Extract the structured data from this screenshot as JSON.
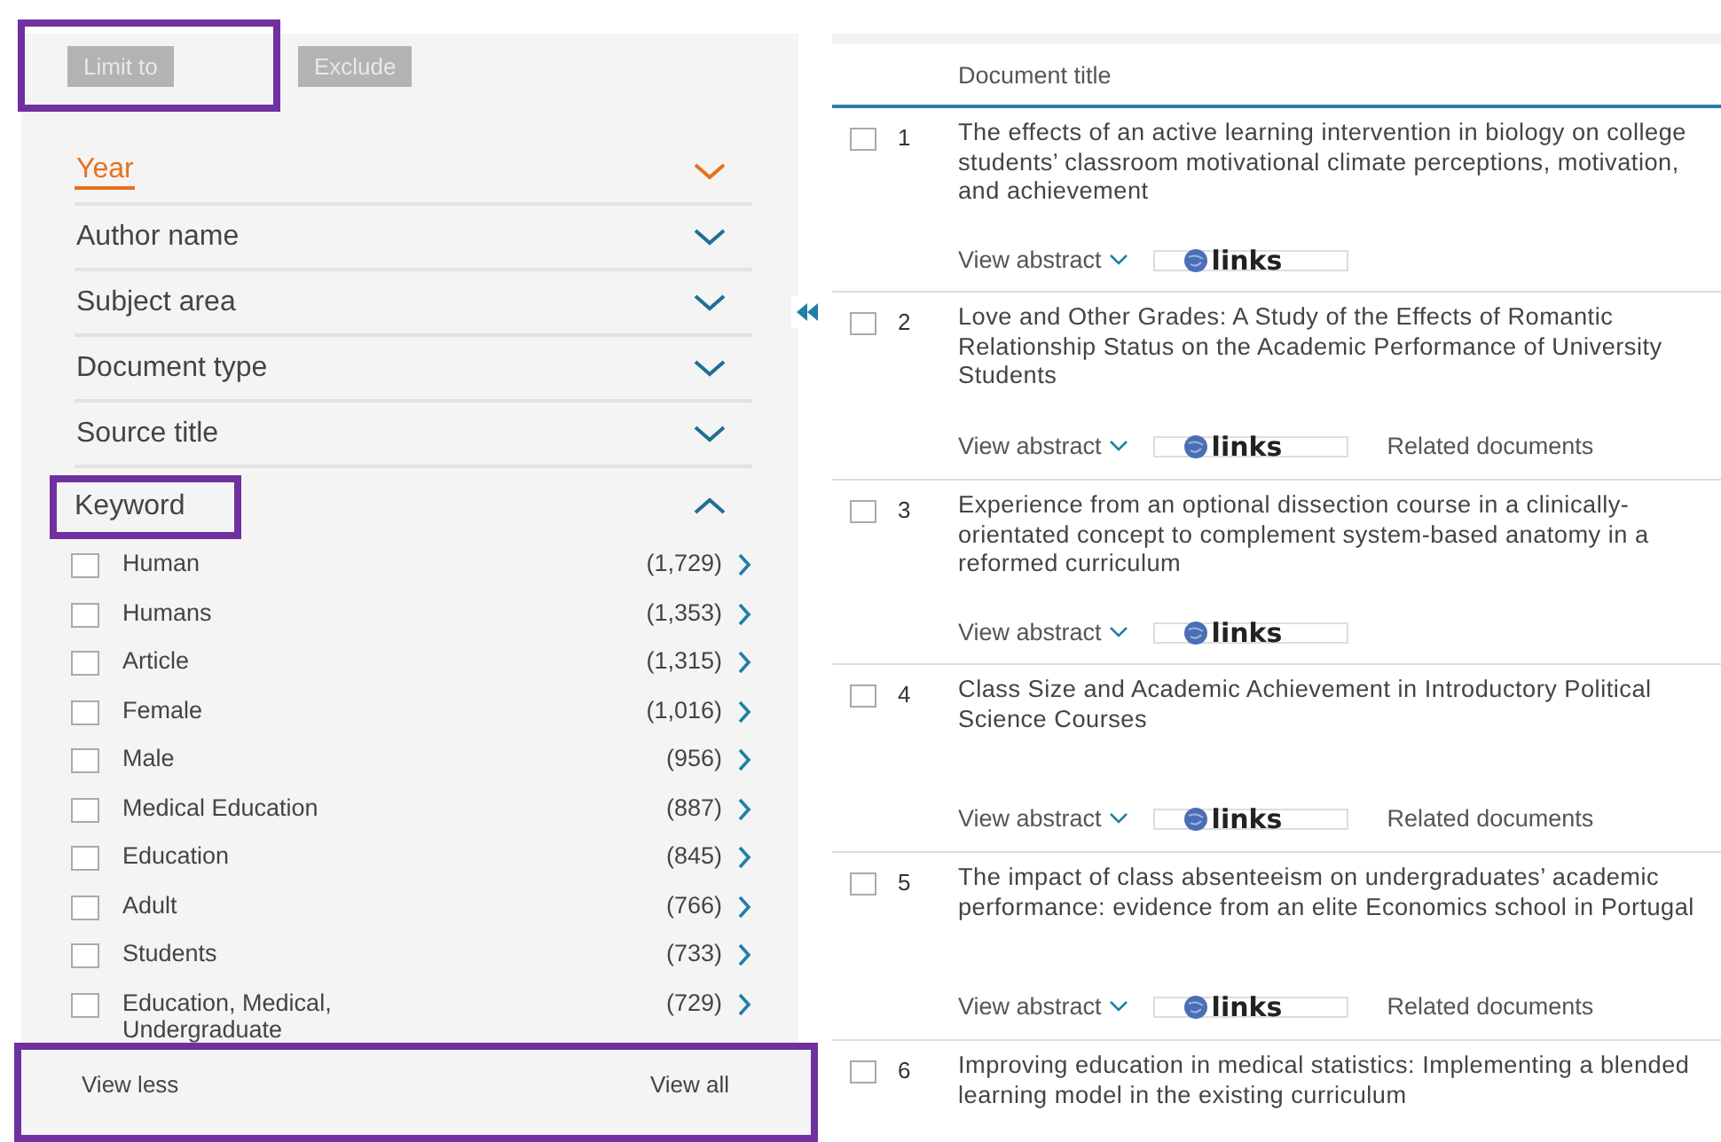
{
  "refine": {
    "highlighted": true,
    "buttons": [
      {
        "label": "Limit to",
        "disabled": true
      },
      {
        "label": "Exclude",
        "disabled": true
      }
    ]
  },
  "facets": [
    {
      "label": "Year",
      "selected": true,
      "expanded": false,
      "highlighted": false
    },
    {
      "label": "Author name",
      "selected": false,
      "expanded": false,
      "highlighted": false
    },
    {
      "label": "Subject area",
      "selected": false,
      "expanded": false,
      "highlighted": false
    },
    {
      "label": "Document type",
      "selected": false,
      "expanded": false,
      "highlighted": false
    },
    {
      "label": "Source title",
      "selected": false,
      "expanded": false,
      "highlighted": false
    },
    {
      "label": "Keyword",
      "selected": false,
      "expanded": true,
      "highlighted": true
    }
  ],
  "keywords": [
    {
      "label": "Human",
      "count": "(1,729)",
      "checked": false
    },
    {
      "label": "Humans",
      "count": "(1,353)",
      "checked": false
    },
    {
      "label": "Article",
      "count": "(1,315)",
      "checked": false
    },
    {
      "label": "Female",
      "count": "(1,016)",
      "checked": false
    },
    {
      "label": "Male",
      "count": "(956)",
      "checked": false
    },
    {
      "label": "Medical Education",
      "count": "(887)",
      "checked": false
    },
    {
      "label": "Education",
      "count": "(845)",
      "checked": false
    },
    {
      "label": "Adult",
      "count": "(766)",
      "checked": false
    },
    {
      "label": "Students",
      "count": "(733)",
      "checked": false
    },
    {
      "label": "Education, Medical, Undergraduate",
      "count": "(729)",
      "checked": false
    }
  ],
  "footer": {
    "highlighted": true,
    "less": "View less",
    "all": "View all"
  },
  "table": {
    "column": "Document title",
    "rows": [
      {
        "number": "1",
        "checked": false,
        "title": "The effects of an active learning intervention in biology on college students’ classroom motivational climate perceptions, motivation, and achievement",
        "abstract": "View abstract",
        "links": "links",
        "related": null
      },
      {
        "number": "2",
        "checked": false,
        "title": "Love and Other Grades: A Study of the Effects of Romantic Relationship Status on the Academic Performance of University Students",
        "abstract": "View abstract",
        "links": "links",
        "related": "Related documents"
      },
      {
        "number": "3",
        "checked": false,
        "title": "Experience from an optional dissection course in a clinically-orientated concept to complement system-based anatomy in a reformed curriculum",
        "abstract": "View abstract",
        "links": "links",
        "related": null
      },
      {
        "number": "4",
        "checked": false,
        "title": "Class Size and Academic Achievement in Introductory Political Science Courses",
        "abstract": "View abstract",
        "links": "links",
        "related": "Related documents"
      },
      {
        "number": "5",
        "checked": false,
        "title": "The impact of class absenteeism on undergraduates’ academic performance: evidence from an elite Economics school in Portugal",
        "abstract": "View abstract",
        "links": "links",
        "related": "Related documents"
      },
      {
        "number": "6",
        "checked": false,
        "title": "Improving education in medical statistics: Implementing a blended learning model in the existing curriculum",
        "abstract": null,
        "links": null,
        "related": null
      }
    ]
  }
}
